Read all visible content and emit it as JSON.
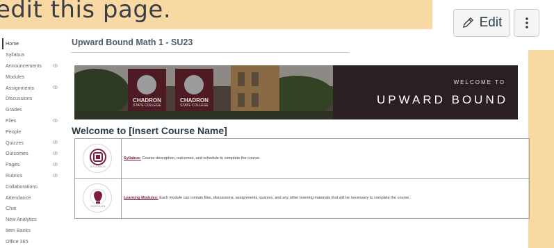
{
  "slide": {
    "heading": "edit this page."
  },
  "header": {
    "edit_label": "Edit",
    "course_title": "Upward Bound Math 1 - SU23"
  },
  "nav": {
    "items": [
      {
        "label": "Home",
        "active": true,
        "visibility_icon": false
      },
      {
        "label": "Syllabus",
        "active": false,
        "visibility_icon": false
      },
      {
        "label": "Announcements",
        "active": false,
        "visibility_icon": true
      },
      {
        "label": "Modules",
        "active": false,
        "visibility_icon": false
      },
      {
        "label": "Assignments",
        "active": false,
        "visibility_icon": true
      },
      {
        "label": "Discussions",
        "active": false,
        "visibility_icon": false
      },
      {
        "label": "Grades",
        "active": false,
        "visibility_icon": false
      },
      {
        "label": "Files",
        "active": false,
        "visibility_icon": true
      },
      {
        "label": "People",
        "active": false,
        "visibility_icon": false
      },
      {
        "label": "Quizzes",
        "active": false,
        "visibility_icon": true
      },
      {
        "label": "Outcomes",
        "active": false,
        "visibility_icon": true
      },
      {
        "label": "Pages",
        "active": false,
        "visibility_icon": true
      },
      {
        "label": "Rubrics",
        "active": false,
        "visibility_icon": true
      },
      {
        "label": "Collaborations",
        "active": false,
        "visibility_icon": false
      },
      {
        "label": "Attendance",
        "active": false,
        "visibility_icon": false
      },
      {
        "label": "Chat",
        "active": false,
        "visibility_icon": false
      },
      {
        "label": "New Analytics",
        "active": false,
        "visibility_icon": false
      },
      {
        "label": "Item Banks",
        "active": false,
        "visibility_icon": false
      },
      {
        "label": "Office 365",
        "active": false,
        "visibility_icon": false
      }
    ]
  },
  "banner": {
    "welcome": "WELCOME TO",
    "title": "UPWARD BOUND",
    "flag_line1": "CHADRON",
    "flag_line2": "STATE COLLEGE"
  },
  "content": {
    "welcome_heading": "Welcome to [Insert Course Name]",
    "rows": [
      {
        "icon": "syllabus-icon",
        "icon_caption": "SYLLABUS",
        "link": "Syllabus:",
        "text": " Course description, outcomes, and schedule to complete the course."
      },
      {
        "icon": "modules-icon",
        "icon_caption": "MODULES",
        "link": "Learning Modules:",
        "text": " Each module can contain files, discussions, assignments, quizzes, and any other learning materials that will be necessary to complete the course."
      }
    ]
  },
  "colors": {
    "accent": "#7c1d3c",
    "background": "#f9d9a3"
  }
}
